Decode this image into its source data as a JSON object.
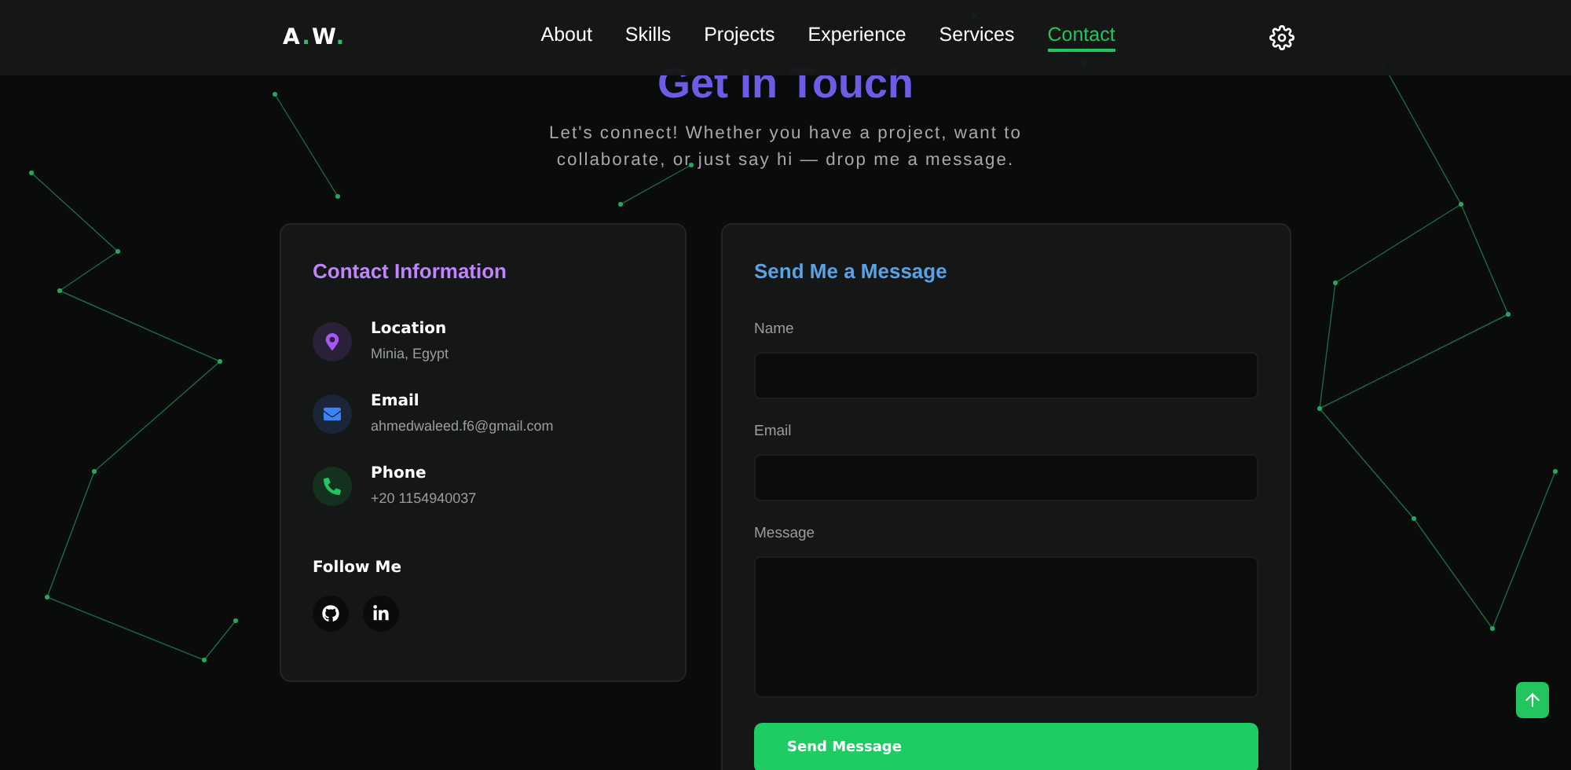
{
  "logo": [
    {
      "text": "A",
      "accent": false
    },
    {
      "text": ".",
      "accent": true
    },
    {
      "text": "W",
      "accent": false
    },
    {
      "text": ".",
      "accent": true
    }
  ],
  "nav": [
    {
      "label": "About",
      "selected": false
    },
    {
      "label": "Skills",
      "selected": false
    },
    {
      "label": "Projects",
      "selected": false
    },
    {
      "label": "Experience",
      "selected": false
    },
    {
      "label": "Services",
      "selected": false
    },
    {
      "label": "Contact",
      "selected": true
    }
  ],
  "heading": "Get In Touch",
  "subtitle": "Let's connect! Whether you have a project, want to collaborate, or just say hi — drop me a message.",
  "contact_info": {
    "title": "Contact Information",
    "items": [
      {
        "kind": "location",
        "label": "Location",
        "value": "Minia, Egypt",
        "color": "#a855f7"
      },
      {
        "kind": "email",
        "label": "Email",
        "value": "ahmedwaleed.f6@gmail.com",
        "color": "#3b82f6"
      },
      {
        "kind": "phone",
        "label": "Phone",
        "value": "+20 1154940037",
        "color": "#22c55e"
      }
    ],
    "follow_title": "Follow Me",
    "socials": [
      {
        "kind": "github"
      },
      {
        "kind": "linkedin"
      }
    ]
  },
  "form": {
    "title": "Send Me a Message",
    "fields": [
      {
        "kind": "input",
        "label": "Name"
      },
      {
        "kind": "input",
        "label": "Email"
      },
      {
        "kind": "textarea",
        "label": "Message"
      }
    ],
    "submit": "Send Message"
  }
}
